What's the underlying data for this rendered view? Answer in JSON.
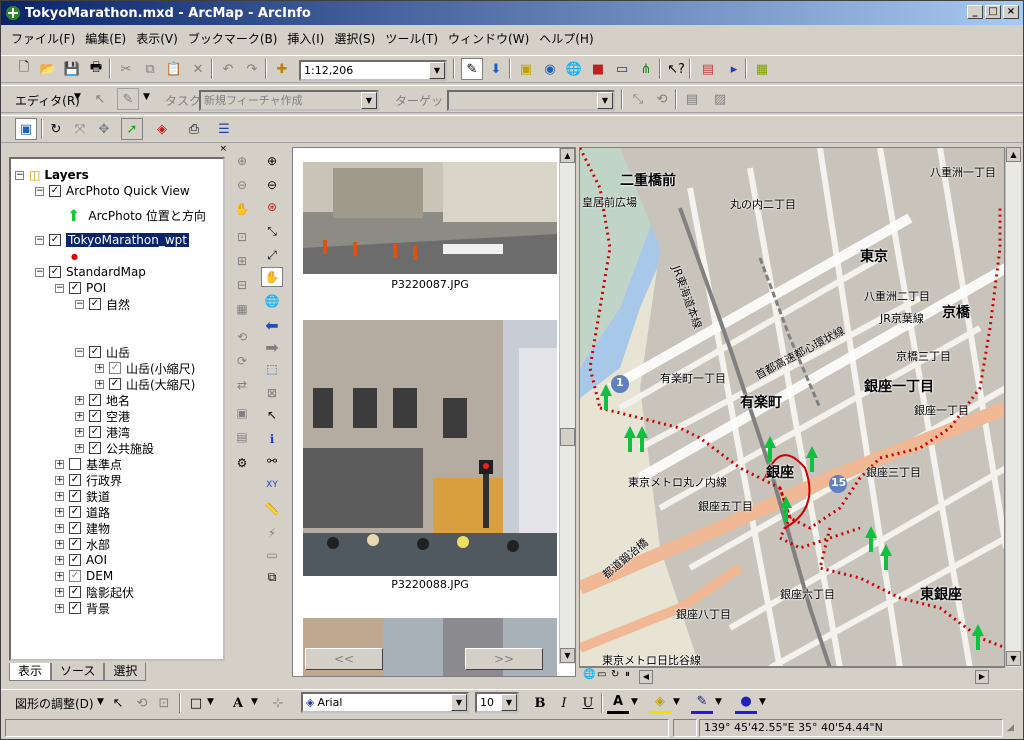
{
  "window": {
    "title": "TokyoMarathon.mxd - ArcMap - ArcInfo"
  },
  "menu": [
    "ファイル(F)",
    "編集(E)",
    "表示(V)",
    "ブックマーク(B)",
    "挿入(I)",
    "選択(S)",
    "ツール(T)",
    "ウィンドウ(W)",
    "ヘルプ(H)"
  ],
  "standard_toolbar": {
    "scale": "1:12,206"
  },
  "editor_toolbar": {
    "editor_label": "エディタ(R)",
    "task_label": "タスク:",
    "task_value": "新規フィーチャ作成",
    "target_label": "ターゲット:",
    "target_value": ""
  },
  "toc": {
    "root": "Layers",
    "items": [
      {
        "label": "ArcPhoto Quick View",
        "checked": true
      },
      {
        "label": "ArcPhoto 位置と方向"
      },
      {
        "label": "TokyoMarathon_wpt",
        "checked": true,
        "selected": true
      },
      {
        "label": "StandardMap",
        "checked": true
      },
      {
        "label": "POI",
        "checked": true
      },
      {
        "label": "自然",
        "checked": true
      },
      {
        "label": "山岳",
        "checked": true
      },
      {
        "label": "山岳(小縮尺)",
        "checked": true
      },
      {
        "label": "山岳(大縮尺)",
        "checked": true
      },
      {
        "label": "地名",
        "checked": true
      },
      {
        "label": "空港",
        "checked": true
      },
      {
        "label": "港湾",
        "checked": true
      },
      {
        "label": "公共施設",
        "checked": true
      },
      {
        "label": "基準点",
        "checked": false
      },
      {
        "label": "行政界",
        "checked": true
      },
      {
        "label": "鉄道",
        "checked": true
      },
      {
        "label": "道路",
        "checked": true
      },
      {
        "label": "建物",
        "checked": true
      },
      {
        "label": "水部",
        "checked": true
      },
      {
        "label": "AOI",
        "checked": true
      },
      {
        "label": "DEM",
        "checked": true
      },
      {
        "label": "陰影起伏",
        "checked": true
      },
      {
        "label": "背景",
        "checked": true
      }
    ],
    "tabs": [
      "表示",
      "ソース",
      "選択"
    ]
  },
  "photos": {
    "captions": [
      "P3220087.JPG",
      "P3220088.JPG"
    ],
    "prev": "<<",
    "next": ">>"
  },
  "map_labels": {
    "l1": "二重橋前",
    "l2": "皇居前広場",
    "l3": "丸の内二丁目",
    "l4": "東京",
    "l5": "八重洲一丁目",
    "l6": "八重洲二丁目",
    "l7": "京橋",
    "l8": "JR京葉線",
    "l9": "京橋三丁目",
    "l10": "有楽町一丁目",
    "l11": "有楽町",
    "l12": "銀座一丁目",
    "l13": "銀座一丁目",
    "l14": "銀座",
    "l15": "銀座三丁目",
    "l16": "銀座五丁目",
    "l17": "東京メトロ丸ノ内線",
    "l18": "銀座六丁目",
    "l19": "銀座八丁目",
    "l20": "東銀座",
    "l21": "東京メトロ日比谷線",
    "l22": "都道鍛冶橋",
    "l23": "1",
    "l24": "15",
    "l25": "JR東海道本線",
    "l26": "首都高速都心環状線"
  },
  "format_toolbar": {
    "draw_label": "図形の調整(D)",
    "font": "Arial",
    "size": "10",
    "bold": "B",
    "italic": "I",
    "underline": "U"
  },
  "status": {
    "coords": "139° 45'42.55\"E  35° 40'54.44\"N"
  }
}
